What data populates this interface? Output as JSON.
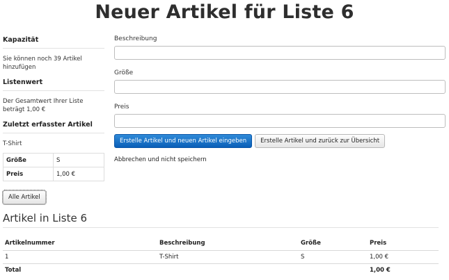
{
  "page": {
    "title": "Neuer Artikel für Liste 6"
  },
  "sidebar": {
    "capacity": {
      "heading": "Kapazität",
      "text": "Sie können noch 39 Artikel hinzufügen"
    },
    "list_value": {
      "heading": "Listenwert",
      "text": "Der Gesamtwert Ihrer Liste beträgt 1,00 €"
    },
    "last_item": {
      "heading": "Zuletzt erfasster Artikel",
      "name": "T-Shirt",
      "rows": [
        {
          "label": "Größe",
          "value": "S"
        },
        {
          "label": "Preis",
          "value": "1,00 €"
        }
      ]
    },
    "all_items_button": "Alle Artikel"
  },
  "form": {
    "fields": [
      {
        "label": "Beschreibung",
        "value": ""
      },
      {
        "label": "Größe",
        "value": ""
      },
      {
        "label": "Preis",
        "value": ""
      }
    ],
    "submit_new_label": "Erstelle Artikel und neuen Artikel eingeben",
    "submit_back_label": "Erstelle Artikel und zurück zur Übersicht",
    "cancel_label": "Abbrechen und nicht speichern"
  },
  "items": {
    "title": "Artikel in Liste 6",
    "headers": [
      "Artikelnummer",
      "Beschreibung",
      "Größe",
      "Preis"
    ],
    "rows": [
      [
        "1",
        "T-Shirt",
        "S",
        "1,00 €"
      ]
    ],
    "total_label": "Total",
    "total_value": "1,00 €"
  }
}
